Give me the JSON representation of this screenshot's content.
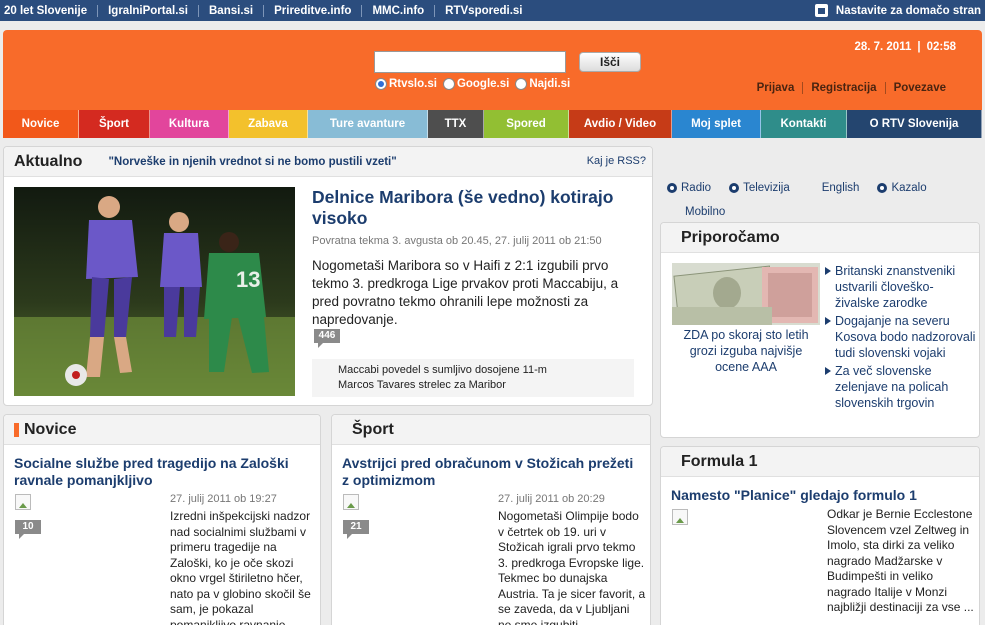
{
  "topbar": {
    "links": [
      "20 let Slovenije",
      "IgralniPortal.si",
      "Bansi.si",
      "Prireditve.info",
      "MMC.info",
      "RTVsporedi.si"
    ],
    "home_link": "Nastavite za domačo stran"
  },
  "header": {
    "search_value": "",
    "search_button": "Išči",
    "engines": [
      {
        "label": "Rtvslo.si",
        "selected": true
      },
      {
        "label": "Google.si",
        "selected": false
      },
      {
        "label": "Najdi.si",
        "selected": false
      }
    ],
    "date": "28. 7. 2011",
    "time": "02:58",
    "account_links": [
      "Prijava",
      "Registracija",
      "Povezave"
    ]
  },
  "nav": [
    {
      "label": "Novice",
      "color": "#f2581a",
      "width": 76
    },
    {
      "label": "Šport",
      "color": "#d42a20",
      "width": 71
    },
    {
      "label": "Kultura",
      "color": "#e2459c",
      "width": 79
    },
    {
      "label": "Zabava",
      "color": "#f3c12c",
      "width": 79
    },
    {
      "label": "Ture avanture",
      "color": "#88bcd6",
      "width": 120
    },
    {
      "label": "TTX",
      "color": "#4e4e4e",
      "width": 56
    },
    {
      "label": "Spored",
      "color": "#92bf33",
      "width": 85
    },
    {
      "label": "Avdio / Video",
      "color": "#c63b17",
      "width": 103
    },
    {
      "label": "Moj splet",
      "color": "#2a86d0",
      "width": 89
    },
    {
      "label": "Kontakti",
      "color": "#2f8d8a",
      "width": 86
    },
    {
      "label": "O RTV Slovenija",
      "color": "#24456f",
      "width": 135
    }
  ],
  "aktualno": {
    "title": "Aktualno",
    "ticker": "\"Norveške in njenih vrednot si ne bomo pustili vzeti\"",
    "rss": "Kaj je RSS?",
    "headline": "Delnice Maribora (še vedno) kotirajo visoko",
    "meta": "Povratna tekma 3. avgusta ob 20.45, 27. julij 2011 ob 21:50",
    "text": "Nogometaši Maribora so v Haifi z 2:1 izgubili prvo tekmo 3. predkroga Lige prvakov proti Maccabiju, a pred povratno tekmo ohranili lepe možnosti za napredovanje.",
    "comments": "446",
    "related": [
      "Maccabi povedel s sumljivo dosojene 11-m",
      "Marcos Tavares strelec za Maribor"
    ]
  },
  "quick_links": {
    "row1": [
      {
        "label": "Radio",
        "icon": "radio-icon"
      },
      {
        "label": "Televizija",
        "icon": "tv-icon"
      },
      {
        "label": "English",
        "icon": ""
      },
      {
        "label": "Kazalo",
        "icon": "index-icon"
      }
    ],
    "row2": "Mobilno"
  },
  "priporocamo": {
    "title": "Priporočamo",
    "caption": "ZDA po skoraj sto letih grozi izguba najvišje ocene AAA",
    "items": [
      "Britanski znanstveniki ustvarili človeško-živalske zarodke",
      "Dogajanje na severu Kosova bodo nadzorovali tudi slovenski vojaki",
      "Za več slovenske zelenjave na policah slovenskih trgovin"
    ]
  },
  "novice": {
    "title": "Novice",
    "headline": "Socialne službe pred tragedijo na Zaloški ravnale pomanjkljivo",
    "meta": "27. julij 2011 ob 19:27",
    "comments": "10",
    "text": "Izredni inšpekcijski nadzor nad socialnimi službami v primeru tragedije na Zaloški, ko je oče skozi okno vrgel štiriletno hčer, nato pa v globino skočil še sam, je pokazal pomanjkljivo ravnanje ..."
  },
  "sport": {
    "title": "Šport",
    "headline": "Avstrijci pred obračunom v Stožicah prežeti z optimizmom",
    "meta": "27. julij 2011 ob 20:29",
    "comments": "21",
    "text": "Nogometaši Olimpije bodo v četrtek ob 19. uri v Stožicah igrali prvo tekmo 3. predkroga Evropske lige. Tekmec bo dunajska Austria. Ta je sicer favorit, a se zaveda, da v Ljubljani ne sme izgubiti."
  },
  "formula": {
    "title": "Formula 1",
    "headline": "Namesto \"Planice\" gledajo formulo 1",
    "text": "Odkar je Bernie Ecclestone Slovencem vzel Zeltweg in Imolo, sta dirki za veliko nagrado Madžarske v Budimpešti in veliko nagrado Italije v Monzi najbližji destinaciji za vse ..."
  }
}
